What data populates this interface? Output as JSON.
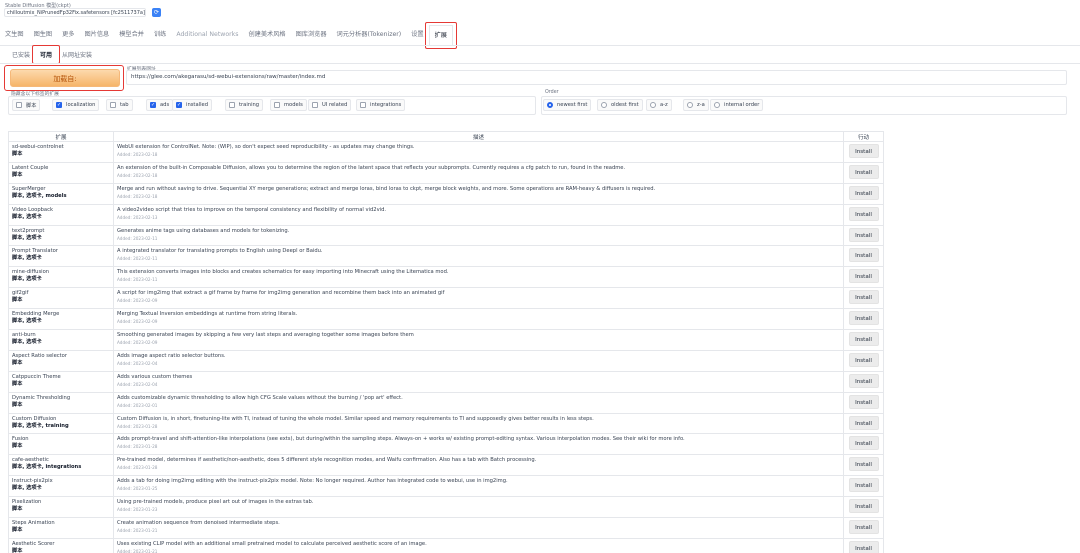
{
  "model": {
    "label": "Stable Diffusion 模型(ckpt)",
    "value": "chilloutmix_NiPrunedFp32Fix.safetensors [fc2511737a]",
    "refresh_icon": "refresh-icon"
  },
  "main_tabs": [
    {
      "label": "文生图",
      "disabled": false,
      "active": false
    },
    {
      "label": "图生图",
      "disabled": false,
      "active": false
    },
    {
      "label": "更多",
      "disabled": false,
      "active": false
    },
    {
      "label": "图片信息",
      "disabled": false,
      "active": false
    },
    {
      "label": "模型合并",
      "disabled": false,
      "active": false
    },
    {
      "label": "训练",
      "disabled": false,
      "active": false
    },
    {
      "label": "Additional Networks",
      "disabled": true,
      "active": false
    },
    {
      "label": "创建美术风格",
      "disabled": false,
      "active": false
    },
    {
      "label": "图库浏览器",
      "disabled": false,
      "active": false
    },
    {
      "label": "词元分析器(Tokenizer)",
      "disabled": false,
      "active": false
    },
    {
      "label": "设置",
      "disabled": false,
      "active": false
    },
    {
      "label": "扩展",
      "disabled": false,
      "active": true
    }
  ],
  "sub_tabs": [
    {
      "label": "已安装",
      "active": false
    },
    {
      "label": "可用",
      "active": true
    },
    {
      "label": "从网址安装",
      "active": false
    }
  ],
  "load_button": "加载自:",
  "url": {
    "label": "扩展列表网址",
    "value": "https://glee.com/akegarasu/sd-webui-extensions/raw/master/index.md"
  },
  "hide": {
    "label": "隐藏含以下标签的扩展",
    "options": [
      {
        "label": "脚本",
        "checked": false
      },
      {
        "label": "localization",
        "checked": true
      },
      {
        "label": "tab",
        "checked": false
      },
      {
        "label": "ads",
        "checked": true
      },
      {
        "label": "installed",
        "checked": true
      },
      {
        "label": "training",
        "checked": false
      },
      {
        "label": "models",
        "checked": false
      },
      {
        "label": "UI related",
        "checked": false
      },
      {
        "label": "integrations",
        "checked": false
      }
    ]
  },
  "order": {
    "label": "Order",
    "options": [
      {
        "label": "newest first",
        "selected": true
      },
      {
        "label": "oldest first",
        "selected": false
      },
      {
        "label": "a-z",
        "selected": false
      },
      {
        "label": "z-a",
        "selected": false
      },
      {
        "label": "internal order",
        "selected": false
      }
    ]
  },
  "table": {
    "headers": [
      "扩展",
      "描述",
      "行动"
    ],
    "install_label": "Install",
    "rows": [
      {
        "name": "sd-webui-controlnet",
        "tags": "脚本",
        "desc": "WebUI extension for ControlNet. Note: (WIP), so don't expect seed reproducibility - as updates may change things.",
        "date": "Added: 2023-02-18"
      },
      {
        "name": "Latent Couple",
        "tags": "脚本",
        "desc": "An extension of the built-in Composable Diffusion, allows you to determine the region of the latent space that reflects your subprompts. Currently requires a cfg patch to run, found in the readme.",
        "date": "Added: 2023-02-18"
      },
      {
        "name": "SuperMerger",
        "tags": "脚本, 选项卡, models",
        "desc": "Merge and run without saving to drive. Sequential XY merge generations; extract and merge loras, bind loras to ckpt, merge block weights, and more. Some operations are RAM-heavy & diffusers is required.",
        "date": "Added: 2023-02-18"
      },
      {
        "name": "Video Loopback",
        "tags": "脚本, 选项卡",
        "desc": "A video2video script that tries to improve on the temporal consistency and flexibility of normal vid2vid.",
        "date": "Added: 2023-02-13"
      },
      {
        "name": "text2prompt",
        "tags": "脚本, 选项卡",
        "desc": "Generates anime tags using databases and models for tokenizing.",
        "date": "Added: 2023-02-11"
      },
      {
        "name": "Prompt Translator",
        "tags": "脚本, 选项卡",
        "desc": "A integrated translator for translating prompts to English using Deepl or Baidu.",
        "date": "Added: 2023-02-11"
      },
      {
        "name": "mine-diffusion",
        "tags": "脚本, 选项卡",
        "desc": "This extension converts images into blocks and creates schematics for easy importing into Minecraft using the Litematica mod.",
        "date": "Added: 2023-02-11"
      },
      {
        "name": "gif2gif",
        "tags": "脚本",
        "desc": "A script for img2img that extract a gif frame by frame for img2img generation and recombine them back into an animated gif",
        "date": "Added: 2023-02-09"
      },
      {
        "name": "Embedding Merge",
        "tags": "脚本, 选项卡",
        "desc": "Merging Textual Inversion embeddings at runtime from string literals.",
        "date": "Added: 2023-02-09"
      },
      {
        "name": "anti-burn",
        "tags": "脚本, 选项卡",
        "desc": "Smoothing generated images by skipping a few very last steps and averaging together some images before them",
        "date": "Added: 2023-02-09"
      },
      {
        "name": "Aspect Ratio selector",
        "tags": "脚本",
        "desc": "Adds image aspect ratio selector buttons.",
        "date": "Added: 2023-02-04"
      },
      {
        "name": "Catppuccin Theme",
        "tags": "脚本",
        "desc": "Adds various custom themes",
        "date": "Added: 2023-02-04"
      },
      {
        "name": "Dynamic Thresholding",
        "tags": "脚本",
        "desc": "Adds customizable dynamic thresholding to allow high CFG Scale values without the burning / 'pop art' effect.",
        "date": "Added: 2023-02-01"
      },
      {
        "name": "Custom Diffusion",
        "tags": "脚本, 选项卡, training",
        "desc": "Custom Diffusion is, in short, finetuning-lite with TI, instead of tuning the whole model. Similar speed and memory requirements to TI and supposedly gives better results in less steps.",
        "date": "Added: 2023-01-28"
      },
      {
        "name": "Fusion",
        "tags": "脚本",
        "desc": "Adds prompt-travel and shift-attention-like interpolations (see exts), but during/within the sampling steps. Always-on + works w/ existing prompt-editing syntax. Various interpolation modes. See their wiki for more info.",
        "date": "Added: 2023-01-28"
      },
      {
        "name": "cafe-aesthetic",
        "tags": "脚本, 选项卡, integrations",
        "desc": "Pre-trained model, determines if aesthetic/non-aesthetic, does 5 different style recognition modes, and Waifu confirmation. Also has a tab with Batch processing.",
        "date": "Added: 2023-01-28"
      },
      {
        "name": "Instruct-pix2pix",
        "tags": "脚本, 选项卡",
        "desc": "Adds a tab for doing img2img editing with the instruct-pix2pix model. Note: No longer required. Author has integrated code to webui, use in img2img.",
        "date": "Added: 2023-01-25"
      },
      {
        "name": "Pixelization",
        "tags": "脚本",
        "desc": "Using pre-trained models, produce pixel art out of images in the extras tab.",
        "date": "Added: 2023-01-23"
      },
      {
        "name": "Steps Animation",
        "tags": "脚本",
        "desc": "Create animation sequence from denoised intermediate steps.",
        "date": "Added: 2023-01-21"
      },
      {
        "name": "Aesthetic Scorer",
        "tags": "脚本",
        "desc": "Uses existing CLIP model with an additional small pretrained model to calculate perceived aesthetic score of an image.",
        "date": "Added: 2023-01-21"
      }
    ]
  }
}
